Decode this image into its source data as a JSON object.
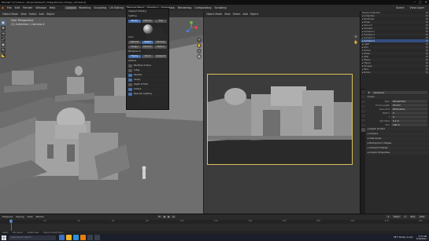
{
  "window": {
    "title": "Blender* [C:\\Users\\...\\Projects\\Desert_Village\\Desert_Village_v03.blend]",
    "controls": [
      "–",
      "▢",
      "✕"
    ]
  },
  "menubar": {
    "menus": [
      "File",
      "Edit",
      "Render",
      "Window",
      "Help"
    ],
    "workspaces": [
      "Layout",
      "Modeling",
      "Sculpting",
      "UV Editing",
      "Texture Paint",
      "Shading",
      "Animation",
      "Rendering",
      "Compositing",
      "Scripting"
    ],
    "active_workspace": "Layout",
    "scene_label": "Scene",
    "view_layer_label": "View Layer"
  },
  "left_viewport": {
    "header_items": [
      "Object Mode",
      "View",
      "Select",
      "Add",
      "Object"
    ],
    "info_line1": "User Perspective",
    "info_line2": "(1) Collection | Camera.4",
    "tools": [
      "▣",
      "✥",
      "⟲",
      "⤢",
      "▦",
      "✎",
      "📐"
    ]
  },
  "right_viewport": {
    "header_items": [
      "Object Mode",
      "View",
      "Select",
      "Add",
      "Object"
    ],
    "popover": {
      "title": "Viewport Shading",
      "lighting_label": "Lighting",
      "lighting_options": [
        "Studio",
        "MatCap",
        "Flat"
      ],
      "color_label": "Color",
      "color_options": [
        "Material",
        "Object",
        "Attribute",
        "Single",
        "Random",
        "Texture"
      ],
      "background_label": "Background",
      "background_options": [
        "Theme",
        "World",
        "Viewport"
      ],
      "options_label": "Options",
      "option_items": [
        "Backface Culling",
        "X-Ray",
        "Shadow",
        "Cavity",
        "Depth of Field",
        "Outline",
        "Specular Lighting"
      ]
    }
  },
  "outliner": {
    "rows": [
      {
        "label": "Scene Collection",
        "sel": false
      },
      {
        "label": "▸ Collection",
        "sel": false
      },
      {
        "label": "  ▸ Buildings",
        "sel": false
      },
      {
        "label": "  ▸ Props",
        "sel": false
      },
      {
        "label": "  ▸ Ground",
        "sel": false
      },
      {
        "label": "  ▸ Camera",
        "sel": false
      },
      {
        "label": "  ▸ Camera.1",
        "sel": false
      },
      {
        "label": "  ▸ Camera.2",
        "sel": false
      },
      {
        "label": "  ▸ Camera.3",
        "sel": false
      },
      {
        "label": "  ▸ Camera.4",
        "sel": true
      },
      {
        "label": "  ▸ Light",
        "sel": false
      },
      {
        "label": "  ▸ Sun",
        "sel": false
      },
      {
        "label": "  ▸ Dome",
        "sel": false
      },
      {
        "label": "  ▸ Tower",
        "sel": false
      },
      {
        "label": "  ▸ Wall",
        "sel": false
      },
      {
        "label": "  ▸ Stairs",
        "sel": false
      },
      {
        "label": "  ▸ Figure",
        "sel": false
      },
      {
        "label": "  ▸ Houses",
        "sel": false
      },
      {
        "label": "  ▸ Tent",
        "sel": false
      },
      {
        "label": "  ▸ Rocks",
        "sel": false
      }
    ]
  },
  "properties": {
    "object_name": "Camera.4",
    "sections": [
      {
        "title": "▾ Lens",
        "fields": [
          [
            "Type",
            "Perspective"
          ],
          [
            "Focal Length",
            "50 mm"
          ],
          [
            "Lens Unit",
            "Millimeters"
          ],
          [
            "Shift X",
            "0"
          ],
          [
            "Y",
            "0"
          ],
          [
            "Clip Start",
            "0.1 m"
          ],
          [
            "End",
            "100 m"
          ]
        ]
      },
      {
        "title": "▸ Depth of Field",
        "fields": []
      },
      {
        "title": "▸ Camera",
        "fields": []
      },
      {
        "title": "▸ Safe Areas",
        "fields": []
      },
      {
        "title": "▸ Background Images",
        "fields": []
      },
      {
        "title": "▸ Viewport Display",
        "fields": []
      },
      {
        "title": "▸ Custom Properties",
        "fields": []
      }
    ]
  },
  "timeline": {
    "menu": [
      "Playback",
      "Keying",
      "View",
      "Marker"
    ],
    "play_buttons": [
      "⏮",
      "◀",
      "▶",
      "⏭"
    ],
    "current_frame": "1",
    "start_label": "Start",
    "start": "1",
    "end_label": "End",
    "end": "250",
    "ticks": [
      "0",
      "20",
      "40",
      "60",
      "80",
      "100",
      "120",
      "140",
      "160",
      "180",
      "200",
      "220",
      "240"
    ]
  },
  "statusbar": {
    "items": [
      "Select",
      "Box Select",
      "Rotate View",
      "Object Context Menu"
    ]
  },
  "taskbar": {
    "search_placeholder": "Type here to search",
    "time": "4:57 PM",
    "date": "3/16/2021",
    "weather": "58°F Mostly cloudy"
  },
  "colors": {
    "accent": "#4772b3",
    "camera_frame": "#d8c15a",
    "viewport_bg": "#5a5a5a"
  }
}
